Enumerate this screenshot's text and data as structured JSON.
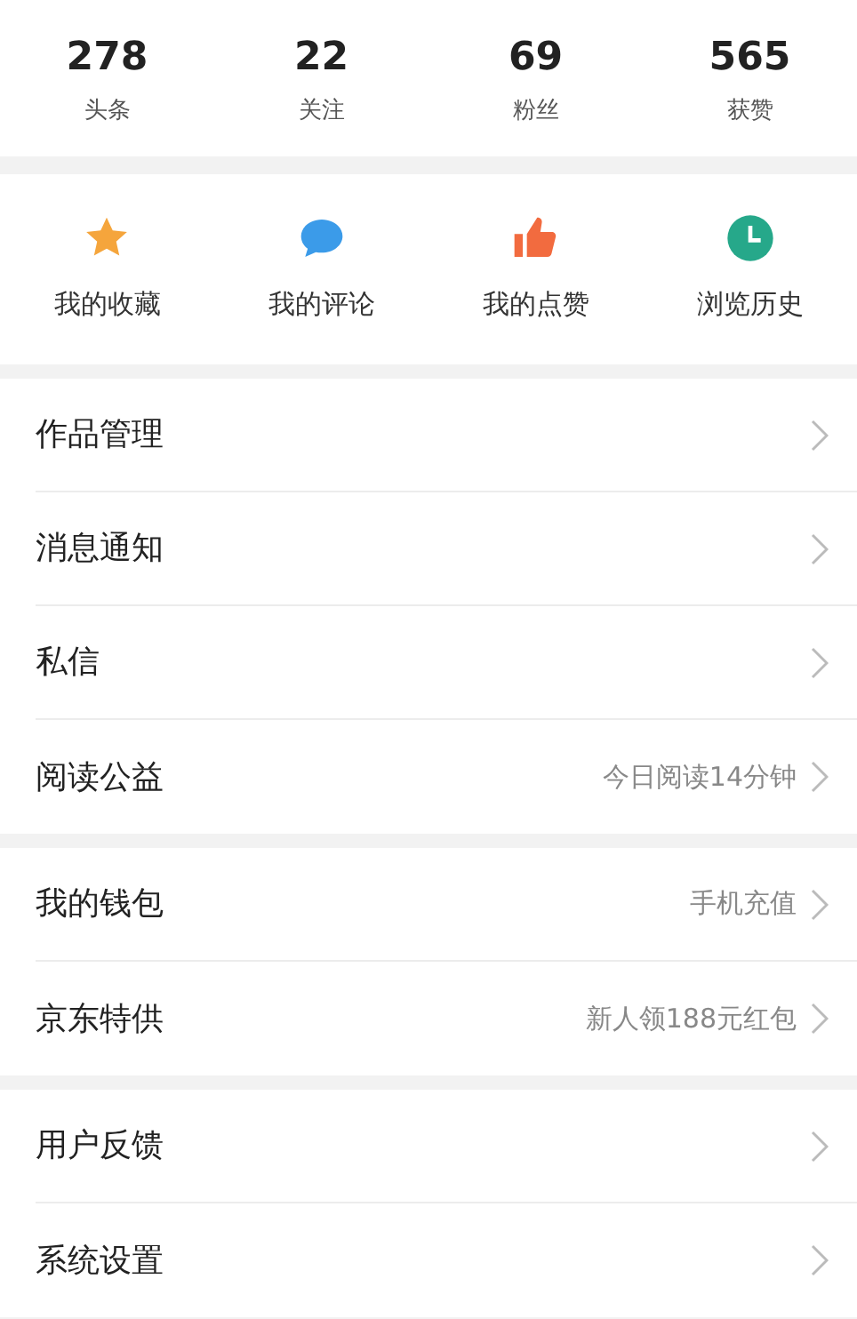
{
  "stats": [
    {
      "value": "278",
      "label": "头条"
    },
    {
      "value": "22",
      "label": "关注"
    },
    {
      "value": "69",
      "label": "粉丝"
    },
    {
      "value": "565",
      "label": "获赞"
    }
  ],
  "shortcuts": [
    {
      "kind": "star",
      "label": "我的收藏",
      "color": "#f5a53c"
    },
    {
      "kind": "comment",
      "label": "我的评论",
      "color": "#3b9be9"
    },
    {
      "kind": "like",
      "label": "我的点赞",
      "color": "#f26b3f"
    },
    {
      "kind": "history",
      "label": "浏览历史",
      "color": "#26a88a"
    }
  ],
  "menu_groups": [
    {
      "items": [
        {
          "label": "作品管理"
        },
        {
          "label": "消息通知"
        },
        {
          "label": "私信"
        },
        {
          "label": "阅读公益",
          "detail": "今日阅读14分钟"
        }
      ]
    },
    {
      "items": [
        {
          "label": "我的钱包",
          "detail": "手机充值"
        },
        {
          "label": "京东特供",
          "detail": "新人领188元红包"
        }
      ]
    },
    {
      "items": [
        {
          "label": "用户反馈"
        },
        {
          "label": "系统设置"
        }
      ]
    }
  ]
}
